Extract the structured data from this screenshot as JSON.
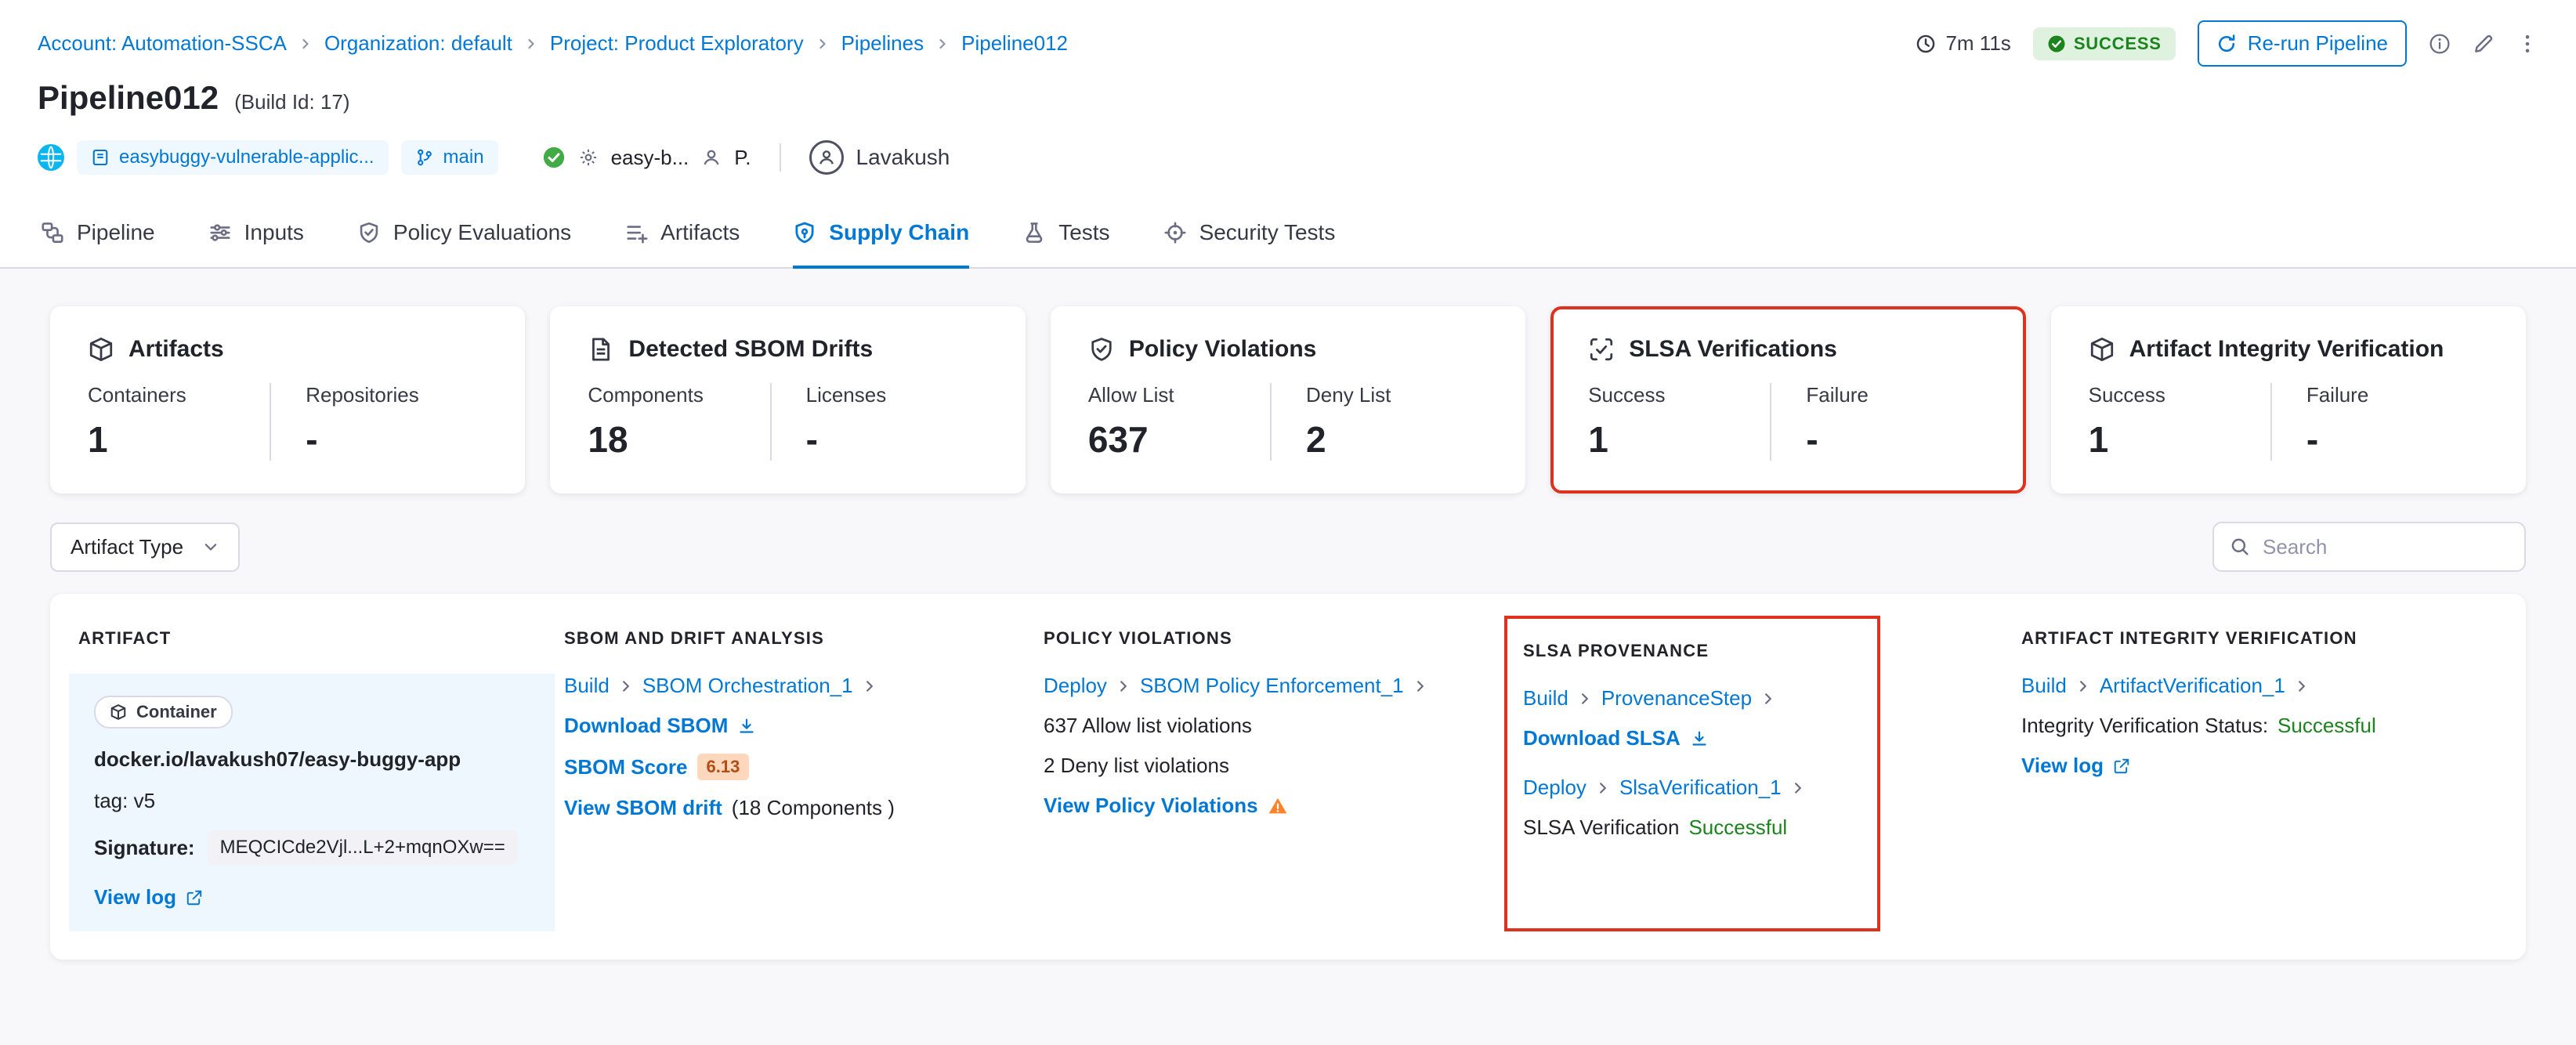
{
  "colors": {
    "accent_blue": "#0278d5",
    "success_green": "#1b841d",
    "highlight_red": "#e0301e",
    "warning_orange": "#ff832b"
  },
  "breadcrumb": {
    "items": [
      "Account: Automation-SSCA",
      "Organization: default",
      "Project: Product Exploratory",
      "Pipelines",
      "Pipeline012"
    ]
  },
  "header": {
    "title": "Pipeline012",
    "build_id": "(Build Id: 17)",
    "duration": "7m 11s",
    "status": "SUCCESS",
    "rerun_label": "Re-run Pipeline",
    "repo": "easybuggy-vulnerable-applic...",
    "branch": "main",
    "commit_ref": "easy-b...",
    "trigger_user_short": "P.",
    "user": "Lavakush"
  },
  "tabs": [
    {
      "label": "Pipeline"
    },
    {
      "label": "Inputs"
    },
    {
      "label": "Policy Evaluations"
    },
    {
      "label": "Artifacts"
    },
    {
      "label": "Supply Chain"
    },
    {
      "label": "Tests"
    },
    {
      "label": "Security Tests"
    }
  ],
  "cards": [
    {
      "title": "Artifacts",
      "cols": [
        {
          "label": "Containers",
          "value": "1"
        },
        {
          "label": "Repositories",
          "value": "-"
        }
      ]
    },
    {
      "title": "Detected SBOM Drifts",
      "cols": [
        {
          "label": "Components",
          "value": "18"
        },
        {
          "label": "Licenses",
          "value": "-"
        }
      ]
    },
    {
      "title": "Policy Violations",
      "cols": [
        {
          "label": "Allow List",
          "value": "637"
        },
        {
          "label": "Deny List",
          "value": "2"
        }
      ]
    },
    {
      "title": "SLSA Verifications",
      "cols": [
        {
          "label": "Success",
          "value": "1"
        },
        {
          "label": "Failure",
          "value": "-"
        }
      ]
    },
    {
      "title": "Artifact Integrity Verification",
      "cols": [
        {
          "label": "Success",
          "value": "1"
        },
        {
          "label": "Failure",
          "value": "-"
        }
      ]
    }
  ],
  "filters": {
    "artifact_type_label": "Artifact Type",
    "search_placeholder": "Search"
  },
  "table": {
    "headers": [
      "ARTIFACT",
      "SBOM AND DRIFT ANALYSIS",
      "POLICY VIOLATIONS",
      "SLSA PROVENANCE",
      "ARTIFACT INTEGRITY VERIFICATION"
    ],
    "row": {
      "artifact": {
        "type_badge": "Container",
        "image": "docker.io/lavakush07/easy-buggy-app",
        "tag": "tag: v5",
        "signature_label": "Signature:",
        "signature_value": "MEQCICde2Vjl...L+2+mqnOXw==",
        "view_log": "View log"
      },
      "sbom": {
        "stage": "Build",
        "step": "SBOM Orchestration_1",
        "download": "Download SBOM",
        "score_label": "SBOM Score",
        "score": "6.13",
        "drift_link": "View SBOM drift",
        "drift_components": "(18 Components )"
      },
      "policy": {
        "stage": "Deploy",
        "step": "SBOM Policy Enforcement_1",
        "allow": "637 Allow list violations",
        "deny": "2 Deny list violations",
        "view": "View Policy Violations"
      },
      "slsa": {
        "stage1": "Build",
        "step1": "ProvenanceStep",
        "download": "Download SLSA",
        "stage2": "Deploy",
        "step2": "SlsaVerification_1",
        "status_prefix": "SLSA Verification",
        "status": "Successful"
      },
      "integrity": {
        "stage": "Build",
        "step": "ArtifactVerification_1",
        "status_prefix": "Integrity Verification Status:",
        "status": "Successful",
        "view_log": "View log"
      }
    }
  }
}
